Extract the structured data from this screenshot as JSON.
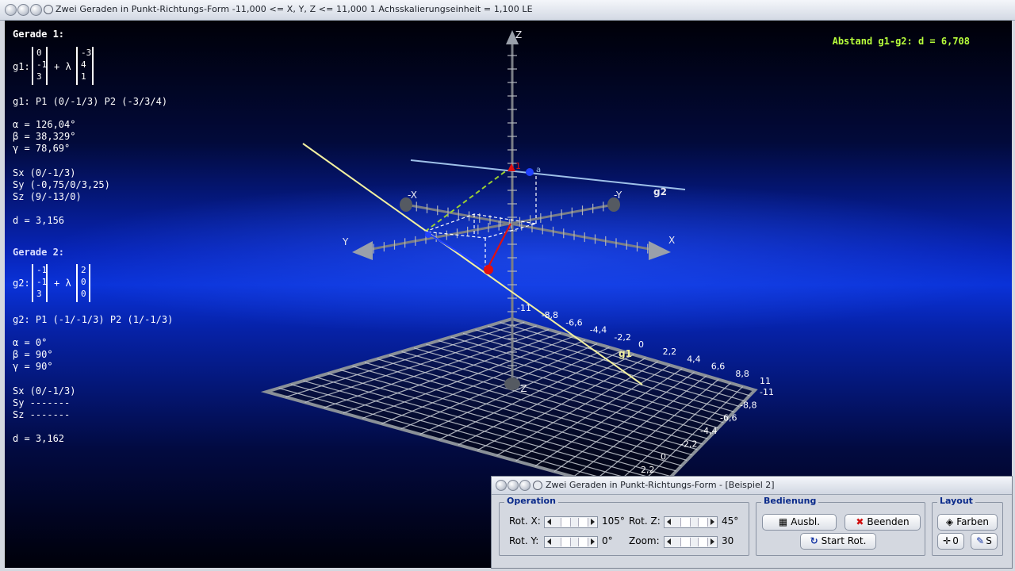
{
  "window": {
    "title": "Zwei Geraden in Punkt-Richtungs-Form   -11,000 <= X, Y, Z <= 11,000    1 Achsskalierungseinheit = 1,100 LE"
  },
  "gerade1": {
    "heading": "Gerade 1:",
    "name": "g1:",
    "point": [
      "0",
      "-1",
      "3"
    ],
    "plus_lambda": "+ λ",
    "direction": [
      "-3",
      "4",
      "1"
    ],
    "points_line": "g1: P1 (0/-1/3)   P2 (-3/3/4)",
    "alpha": "α = 126,04°",
    "beta": "β = 38,329°",
    "gamma": "γ = 78,69°",
    "sx": "Sx (0/-1/3)",
    "sy": "Sy (-0,75/0/3,25)",
    "sz": "Sz (9/-13/0)",
    "d": "d = 3,156"
  },
  "gerade2": {
    "heading": "Gerade 2:",
    "name": "g2:",
    "point": [
      "-1",
      "-1",
      "3"
    ],
    "plus_lambda": "+ λ",
    "direction": [
      "2",
      "0",
      "0"
    ],
    "points_line": "g2: P1 (-1/-1/3)   P2 (1/-1/3)",
    "alpha": "α = 0°",
    "beta": "β = 90°",
    "gamma": "γ = 90°",
    "sx": "Sx (0/-1/3)",
    "sy": "Sy -------",
    "sz": "Sz -------",
    "d": "d = 3,162"
  },
  "distance": "Abstand g1-g2: d = 6,708",
  "scene_labels": {
    "z": "Z",
    "neg_z": "-Z",
    "x": "X",
    "neg_x": "-X",
    "y": "Y",
    "neg_y": "-Y",
    "g1": "g1",
    "g2": "g2",
    "label_1": "1",
    "label_a": "a"
  },
  "grid_ticks": {
    "near_edge": [
      "-11",
      "-8,8",
      "-6,6",
      "-4,4",
      "-2,2",
      "0",
      "2,2",
      "4,4",
      "6,6",
      "8,8",
      "11"
    ],
    "right_edge": [
      "-11",
      "-8,8",
      "-6,6",
      "-4,4",
      "-2,2",
      "0",
      "2,2"
    ]
  },
  "colors": {
    "g1": "#f2f0a0",
    "g2": "#9ec0e8",
    "red_vector": "#e01010",
    "blue_segment": "#2040ff",
    "green_dashed": "#9cd030",
    "distance_text": "#b8ff3c",
    "axis": "#7a7e86",
    "grid": "#c8ccd4"
  },
  "panel": {
    "title": "Zwei Geraden in Punkt-Richtungs-Form - [Beispiel 2]",
    "operation": {
      "label": "Operation",
      "rot_x_label": "Rot. X:",
      "rot_x_value": "105°",
      "rot_z_label": "Rot. Z:",
      "rot_z_value": "45°",
      "rot_y_label": "Rot. Y:",
      "rot_y_value": "0°",
      "zoom_label": "Zoom:",
      "zoom_value": "30"
    },
    "bedienung": {
      "label": "Bedienung",
      "ausbl": "Ausbl.",
      "beenden": "Beenden",
      "start_rot": "Start Rot."
    },
    "layout": {
      "label": "Layout",
      "farben": "Farben",
      "zero": "0",
      "s": "S"
    }
  }
}
